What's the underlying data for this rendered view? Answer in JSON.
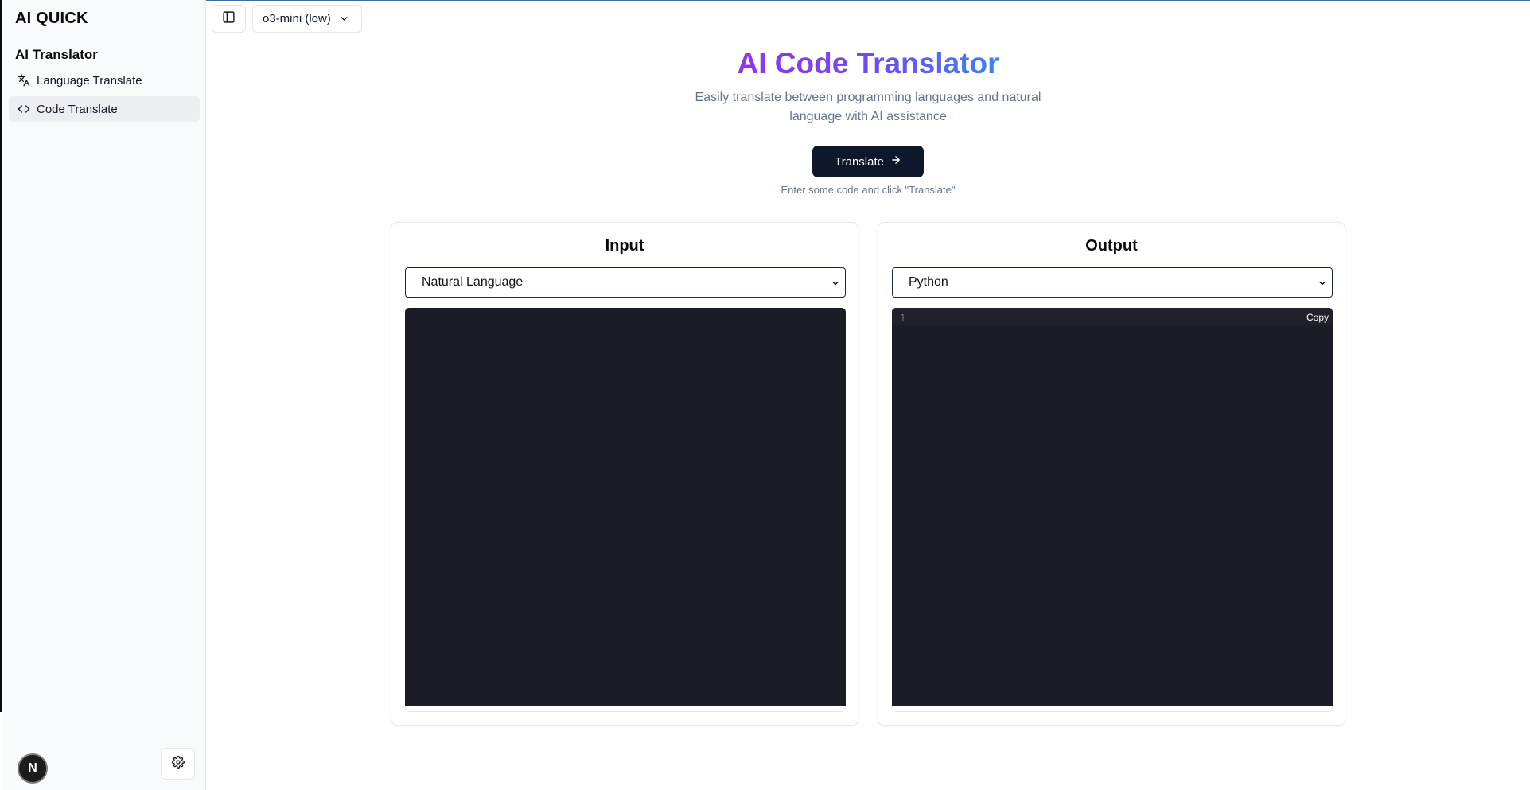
{
  "sidebar": {
    "brand": "AI QUICK",
    "group_title": "AI Translator",
    "items": [
      {
        "label": "Language Translate",
        "icon": "language-icon",
        "active": false
      },
      {
        "label": "Code Translate",
        "icon": "code-icon",
        "active": true
      }
    ],
    "avatar_letter": "N"
  },
  "toolbar": {
    "model_label": "o3-mini (low)"
  },
  "hero": {
    "title": "AI Code Translator",
    "subtitle": "Easily translate between programming languages and natural language with AI assistance",
    "translate_label": "Translate",
    "hint": "Enter some code and click \"Translate\""
  },
  "input_panel": {
    "title": "Input",
    "selected_language": "Natural Language"
  },
  "output_panel": {
    "title": "Output",
    "selected_language": "Python",
    "line_number": "1",
    "copy_label": "Copy"
  },
  "colors": {
    "title_gradient_start": "#9333ea",
    "title_gradient_end": "#3b82f6",
    "primary_button": "#0f172a",
    "editor_bg": "#1b1c26"
  }
}
